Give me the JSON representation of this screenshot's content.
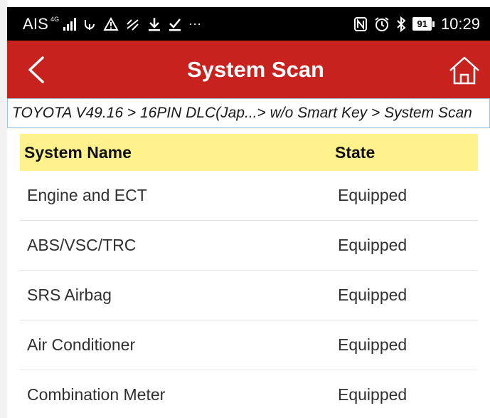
{
  "status_bar": {
    "carrier": "AIS",
    "network_type": "4G",
    "battery": "91",
    "time": "10:29",
    "left_icons": [
      "usb-debug-icon",
      "warning-icon",
      "no-signal-icon",
      "download-icon",
      "checkmark-icon",
      "more-icon"
    ],
    "right_icons": [
      "nfc-icon",
      "alarm-icon",
      "bluetooth-icon",
      "battery-icon"
    ]
  },
  "header": {
    "title": "System Scan",
    "back_icon": "chevron-left-icon",
    "home_icon": "home-icon",
    "color": "#c8221f"
  },
  "breadcrumb": "TOYOTA V49.16 > 16PIN DLC(Jap...> w/o Smart Key > System Scan",
  "table": {
    "header_color": "#fff28c",
    "columns": [
      "System Name",
      "State"
    ],
    "rows": [
      {
        "name": "Engine and ECT",
        "state": "Equipped"
      },
      {
        "name": "ABS/VSC/TRC",
        "state": "Equipped"
      },
      {
        "name": "SRS Airbag",
        "state": "Equipped"
      },
      {
        "name": "Air Conditioner",
        "state": "Equipped"
      },
      {
        "name": "Combination Meter",
        "state": "Equipped"
      }
    ]
  }
}
